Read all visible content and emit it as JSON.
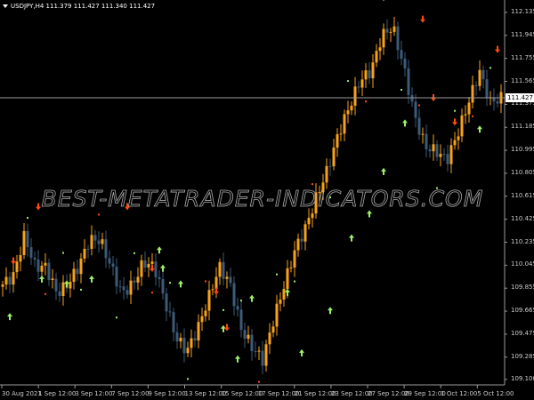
{
  "header": {
    "symbol": "USDJPY,H4",
    "open": "111.379",
    "high": "111.427",
    "low": "111.340",
    "close": "111.427"
  },
  "watermark": "BEST-METATRADER-INDICATORS.COM",
  "current_price": "111.427",
  "colors": {
    "bull": "#f7a21b",
    "bear": "#3d5a78",
    "up_arrow": "#9ef06a",
    "down_arrow": "#ff4a10",
    "dot": "#9ef06a",
    "grid": "#808080"
  },
  "chart_data": {
    "type": "candlestick",
    "y_ticks": [
      "112.135",
      "111.945",
      "111.755",
      "111.565",
      "111.375",
      "111.185",
      "110.995",
      "110.805",
      "110.615",
      "110.425",
      "110.235",
      "110.045",
      "109.855",
      "109.665",
      "109.475",
      "109.285",
      "109.100"
    ],
    "ylim": [
      109.08,
      112.23
    ],
    "x_ticks": [
      "30 Aug 2021",
      "1 Sep 12:00",
      "3 Sep 12:00",
      "7 Sep 12:00",
      "9 Sep 12:00",
      "13 Sep 12:00",
      "15 Sep 12:00",
      "17 Sep 12:00",
      "21 Sep 12:00",
      "23 Sep 12:00",
      "27 Sep 12:00",
      "29 Sep 12:00",
      "1 Oct 12:00",
      "5 Oct 12:00"
    ],
    "key_closes": [
      109.886,
      109.96,
      110.29,
      110.033,
      110.033,
      109.81,
      109.886,
      110.033,
      110.254,
      110.254,
      110.033,
      109.81,
      109.886,
      110.07,
      110.033,
      109.739,
      109.445,
      109.335,
      109.52,
      109.776,
      110.033,
      109.886,
      109.52,
      109.37,
      109.261,
      109.592,
      109.886,
      110.18,
      110.364,
      110.62,
      110.84,
      111.135,
      111.356,
      111.576,
      111.65,
      111.944,
      112.017,
      111.687,
      111.282,
      111.025,
      110.988,
      110.915,
      111.135,
      111.393,
      111.65,
      111.393,
      111.427
    ],
    "up_signals": [
      [
        2,
        109.65
      ],
      [
        11,
        109.96
      ],
      [
        18,
        109.92
      ],
      [
        25,
        109.96
      ],
      [
        44,
        110.2
      ],
      [
        45,
        110.05
      ],
      [
        50,
        109.92
      ],
      [
        62,
        109.55
      ],
      [
        66,
        109.3
      ],
      [
        70,
        109.8
      ],
      [
        80,
        109.85
      ],
      [
        84,
        109.35
      ],
      [
        92,
        109.7
      ],
      [
        98,
        110.3
      ],
      [
        103,
        110.5
      ],
      [
        107,
        110.85
      ],
      [
        113,
        111.25
      ],
      [
        134,
        111.2
      ]
    ],
    "down_signals": [
      [
        3,
        110.05
      ],
      [
        10,
        110.5
      ],
      [
        35,
        110.5
      ],
      [
        42,
        109.99
      ],
      [
        60,
        109.8
      ],
      [
        63,
        109.5
      ],
      [
        118,
        112.05
      ],
      [
        121,
        111.4
      ],
      [
        127,
        111.2
      ],
      [
        139,
        111.8
      ]
    ]
  }
}
